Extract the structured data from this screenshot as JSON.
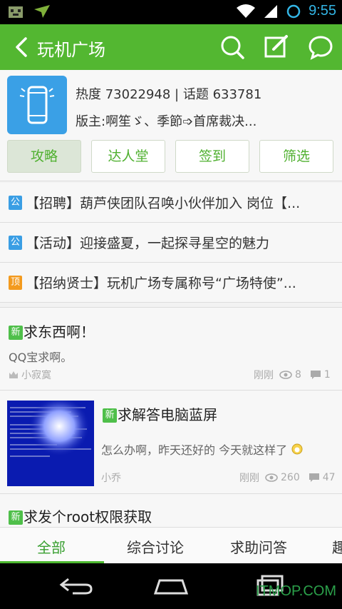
{
  "status_bar": {
    "time": "9:55"
  },
  "header": {
    "title": "玩机广场"
  },
  "forum": {
    "heat": "热度 73022948 | 话题 633781",
    "moderators": "版主:啊笙ゞ、季節➩首席裁决...",
    "buttons": [
      "攻略",
      "达人堂",
      "签到",
      "筛选"
    ]
  },
  "pinned": [
    {
      "badge": "公",
      "badge_color": "#3a9ee4",
      "text": "【招聘】葫芦侠团队召唤小伙伴加入 岗位【..."
    },
    {
      "badge": "公",
      "badge_color": "#3a9ee4",
      "text": "【活动】迎接盛夏，一起探寻星空的魅力"
    },
    {
      "badge": "顶",
      "badge_color": "#f39a1e",
      "text": "【招纳贤士】玩机广场专属称号“广场特使”..."
    }
  ],
  "posts": [
    {
      "badge": "新",
      "title": "求东西啊！",
      "body": "QQ宝求啊。",
      "author": "小寂寞",
      "time": "刚刚",
      "views": "8",
      "comments": "1"
    },
    {
      "badge": "新",
      "title": "求解答电脑蓝屏",
      "body": "怎么办啊，昨天还好的 今天就这样了",
      "author": "小乔",
      "time": "刚刚",
      "views": "260",
      "comments": "47"
    },
    {
      "badge": "新",
      "title": "求发个root权限获取"
    }
  ],
  "tabs": [
    "全部",
    "综合讨论",
    "求助问答",
    "趣"
  ],
  "watermark": "ITMOP.COM",
  "colors": {
    "accent": "#53b731",
    "tab_active": "#3aa032"
  }
}
